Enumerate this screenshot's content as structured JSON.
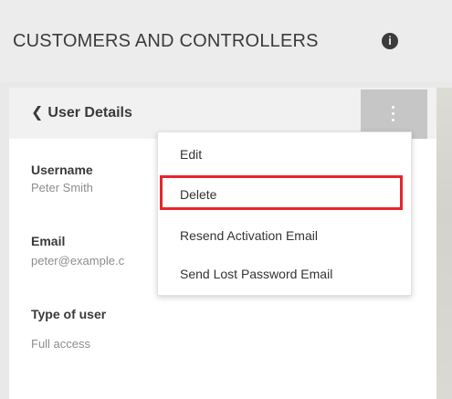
{
  "header": {
    "title": "CUSTOMERS AND CONTROLLERS",
    "info_icon": "info-icon"
  },
  "panel": {
    "back_label": "User Details",
    "back_icon": "chevron-left-icon",
    "menu_icon": "kebab-menu-icon",
    "fields": [
      {
        "label": "Username",
        "value": "Peter Smith"
      },
      {
        "label": "Email",
        "value": "peter@example.c"
      },
      {
        "label": "Type of user",
        "value": "Full access"
      }
    ]
  },
  "dropdown": {
    "items": [
      {
        "label": "Edit"
      },
      {
        "label": "Delete",
        "highlighted": true
      },
      {
        "label": "Resend Activation Email"
      },
      {
        "label": "Send Lost Password Email"
      }
    ]
  },
  "colors": {
    "highlight": "#e5262c",
    "menu_toggle_bg": "#c6c6c6",
    "header_bg": "#ececec"
  }
}
